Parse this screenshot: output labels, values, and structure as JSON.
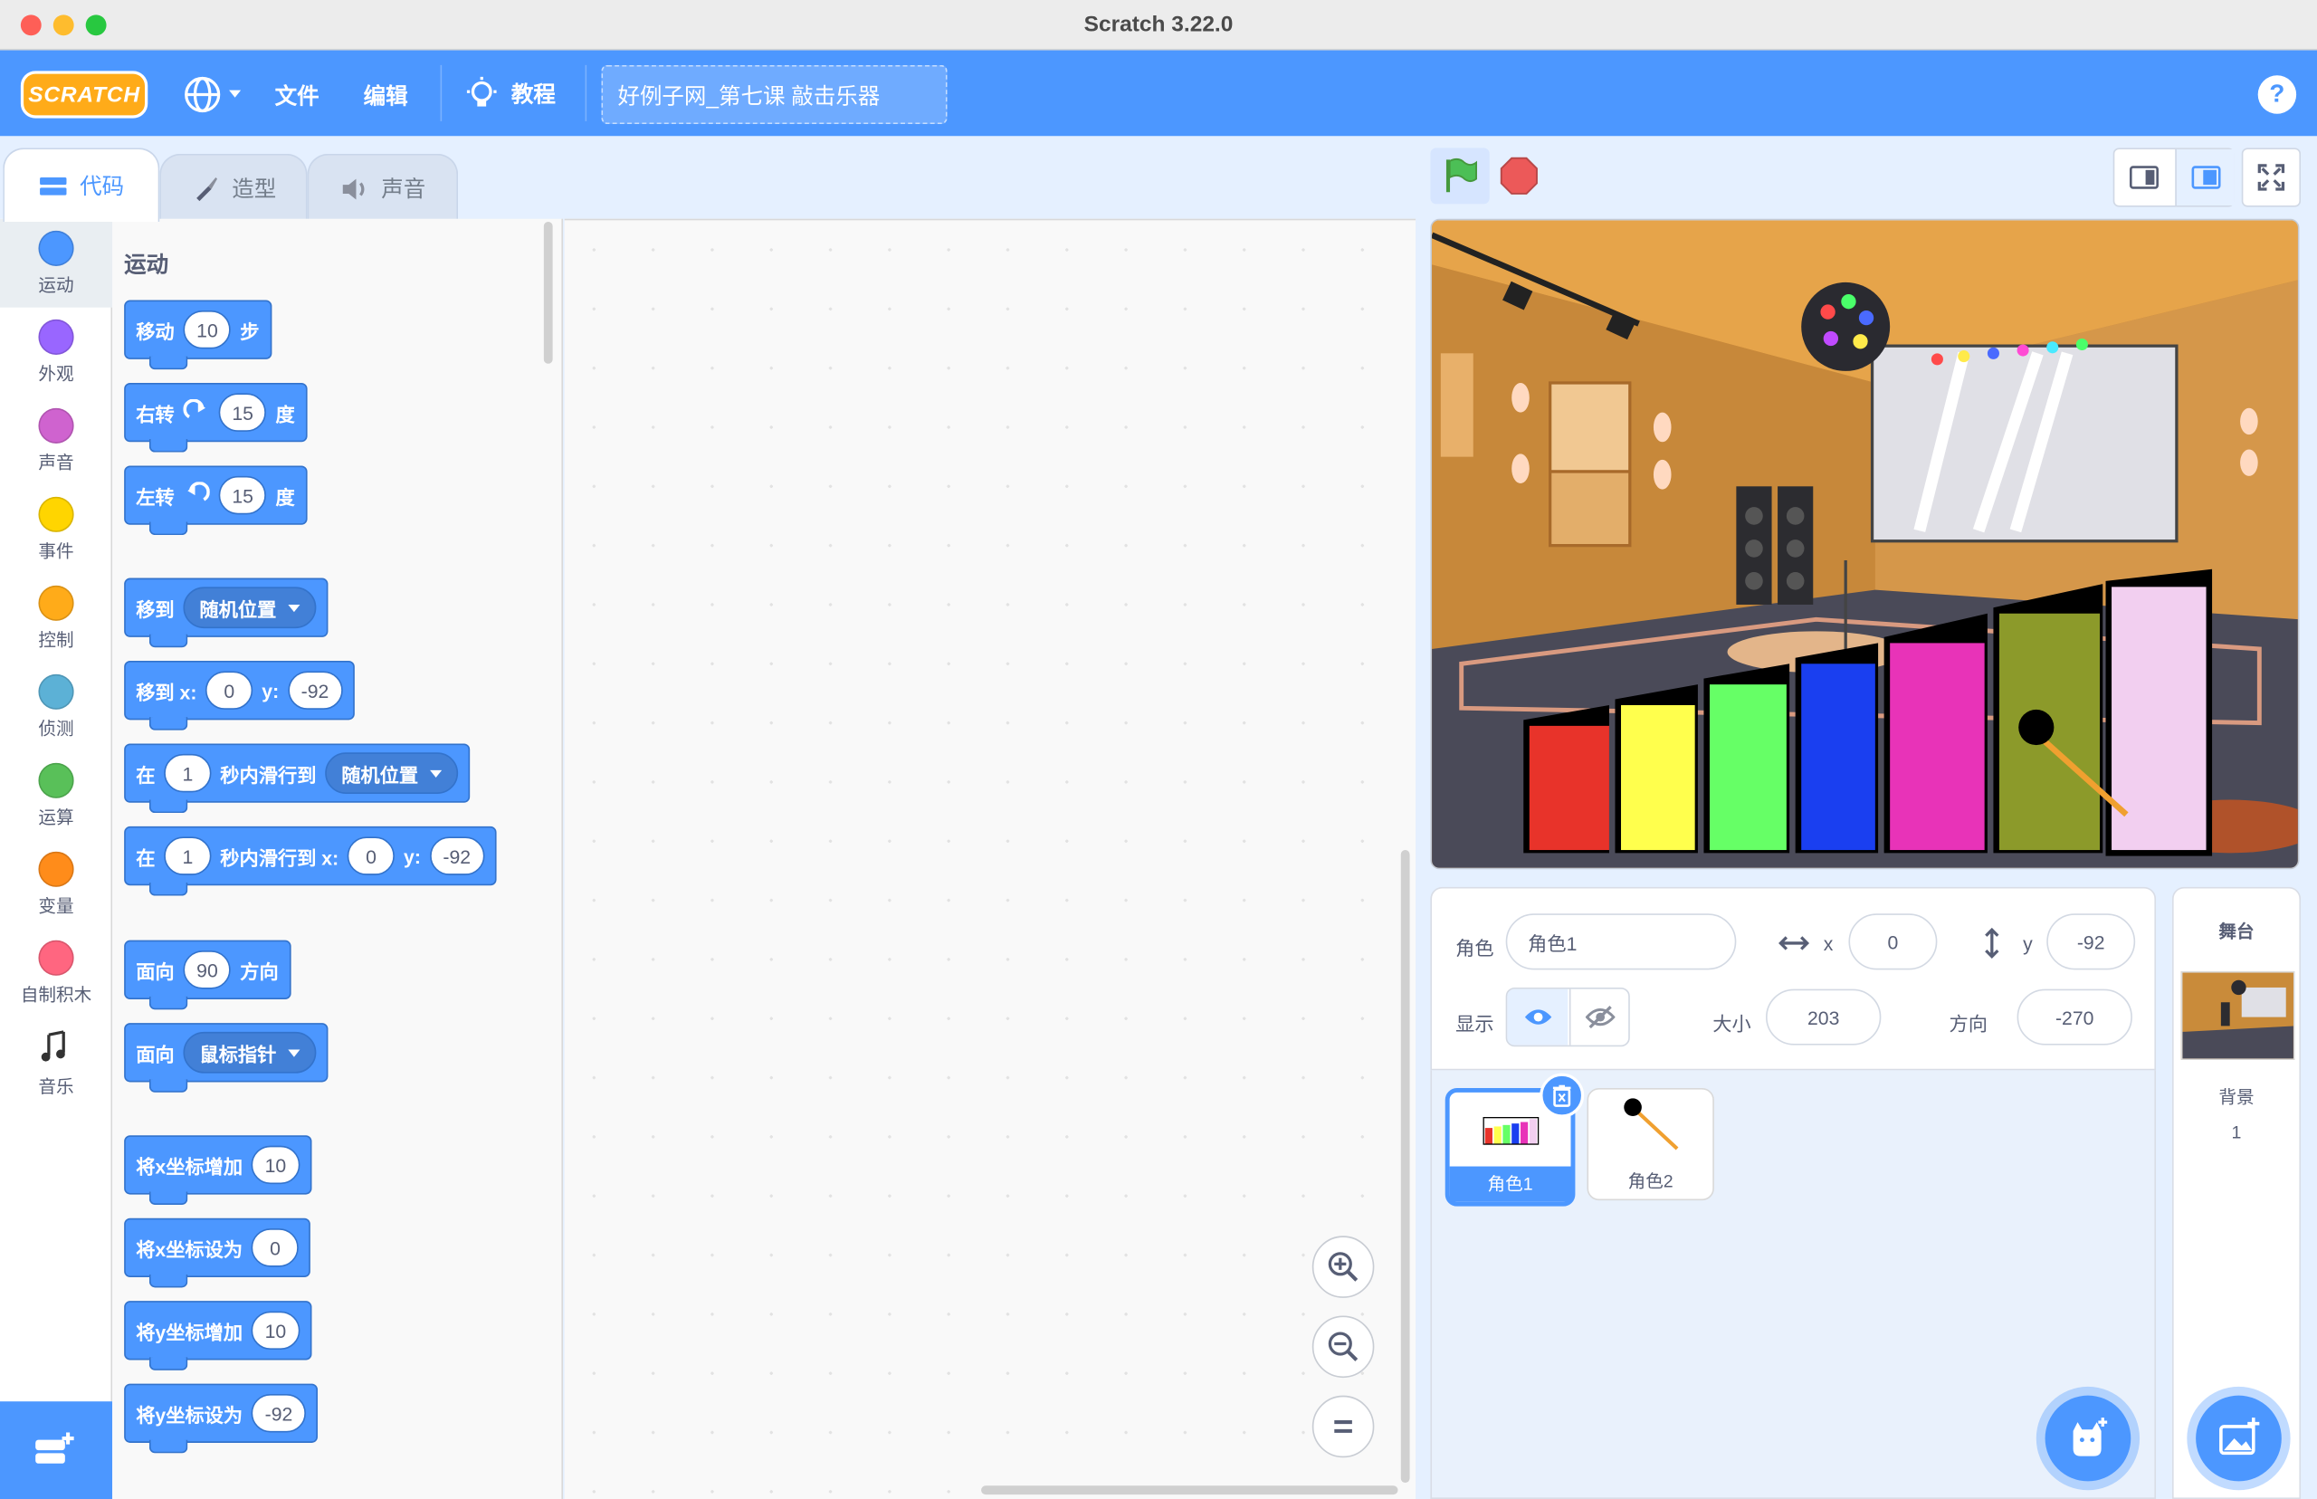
{
  "window": {
    "title": "Scratch 3.22.0"
  },
  "menubar": {
    "logo": "SCRATCH",
    "language_icon": "globe-icon",
    "file": "文件",
    "edit": "编辑",
    "tutorials": "教程",
    "project_title": "好例子网_第七课 敲击乐器",
    "help_icon": "help-icon"
  },
  "tabs": {
    "code": "代码",
    "costumes": "造型",
    "sounds": "声音"
  },
  "categories": [
    {
      "label": "运动",
      "color": "#4c97ff"
    },
    {
      "label": "外观",
      "color": "#9966ff"
    },
    {
      "label": "声音",
      "color": "#cf63cf"
    },
    {
      "label": "事件",
      "color": "#ffd500"
    },
    {
      "label": "控制",
      "color": "#ffab19"
    },
    {
      "label": "侦测",
      "color": "#5cb1d6"
    },
    {
      "label": "运算",
      "color": "#59c059"
    },
    {
      "label": "变量",
      "color": "#ff8c1a"
    },
    {
      "label": "自制积木",
      "color": "#ff6680"
    },
    {
      "label": "音乐",
      "color": ""
    }
  ],
  "palette": {
    "heading": "运动",
    "blocks": {
      "move": {
        "a": "移动",
        "v": "10",
        "b": "步"
      },
      "turn_right": {
        "a": "右转",
        "v": "15",
        "b": "度"
      },
      "turn_left": {
        "a": "左转",
        "v": "15",
        "b": "度"
      },
      "goto": {
        "a": "移到",
        "menu": "随机位置"
      },
      "goto_xy": {
        "a": "移到 x:",
        "x": "0",
        "ylbl": "y:",
        "y": "-92"
      },
      "glide": {
        "a": "在",
        "v": "1",
        "b": "秒内滑行到",
        "menu": "随机位置"
      },
      "glide_xy": {
        "a": "在",
        "v": "1",
        "b": "秒内滑行到 x:",
        "x": "0",
        "ylbl": "y:",
        "y": "-92"
      },
      "point": {
        "a": "面向",
        "v": "90",
        "b": "方向"
      },
      "point_towards": {
        "a": "面向",
        "menu": "鼠标指针"
      },
      "change_x": {
        "a": "将x坐标增加",
        "v": "10"
      },
      "set_x": {
        "a": "将x坐标设为",
        "v": "0"
      },
      "change_y": {
        "a": "将y坐标增加",
        "v": "10"
      },
      "set_y": {
        "a": "将y坐标设为",
        "v": "-92"
      }
    }
  },
  "sprite_info": {
    "sprite_label": "角色",
    "sprite_name": "角色1",
    "x_label": "x",
    "x": "0",
    "y_label": "y",
    "y": "-92",
    "show_label": "显示",
    "size_label": "大小",
    "size": "203",
    "direction_label": "方向",
    "direction": "-270"
  },
  "sprites": [
    {
      "name": "角色1",
      "selected": true
    },
    {
      "name": "角色2",
      "selected": false
    }
  ],
  "stage_panel": {
    "title": "舞台",
    "backdrops_label": "背景",
    "backdrops_count": "1"
  }
}
